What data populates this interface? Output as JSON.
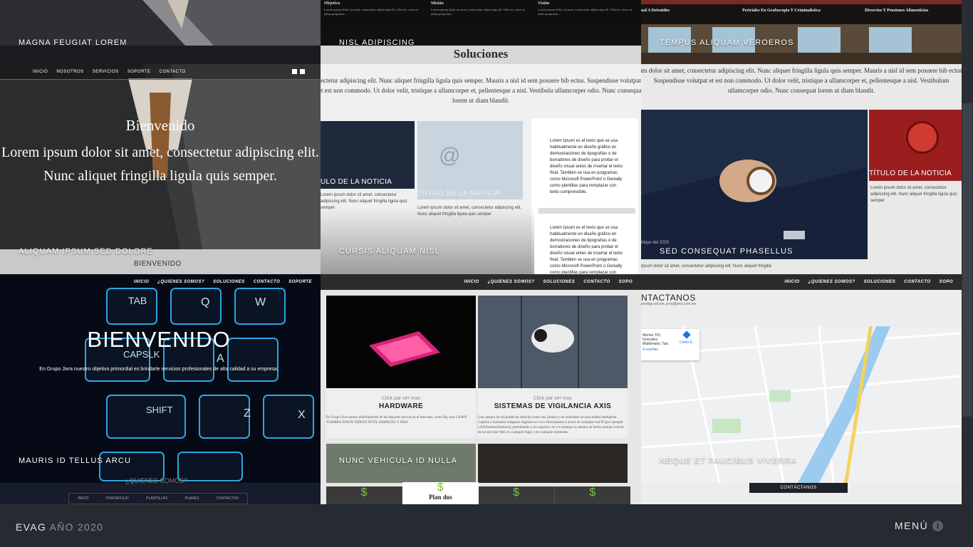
{
  "footer": {
    "brand": "EVAG",
    "year": "AÑO 2020",
    "menu_label": "MENÚ",
    "info_icon": "info-icon"
  },
  "tiles": {
    "t1": {
      "label": "MAGNA FEUGIAT LOREM"
    },
    "t2": {
      "label": "NISL ADIPISCING",
      "heading": "Soluciones",
      "subheading": "BIENVENIDO",
      "columns": [
        "Objetivo",
        "Misión",
        "Visión"
      ],
      "col_text": "Lorem ipsum dolor sit amet, consectetur adipiscing elit. Ultrices, vitae eu nibus proprietor..."
    },
    "t3": {
      "label": "TEMPUS ALIQUAM VEROEROS",
      "top_items": [
        "nal A Detenidos",
        "Periciales En Grafoscopia Y Criminalística",
        "Divorcios Y Pensiones Alimenticias"
      ]
    },
    "t4": {
      "label": "ALIQUAM IPSUM SED DOLORE",
      "nav": [
        "INICIO",
        "NOSOTROS",
        "SERVICIOS",
        "SOPORTE",
        "CONTACTO"
      ],
      "hero_title": "Bienvenido",
      "hero_text": "Lorem ipsum dolor sit amet, consectetur adipiscing elit. Nunc aliquet fringilla ligula quis semper.",
      "bottom": "BIENVENIDO"
    },
    "t5": {
      "label": "CURSIS ALIQUAM NISL",
      "intro": "ectetur adipiscing elit. Nunc aliquet fringilla ligula quis semper. Mauris a nisl id sem posuere bib ectus. Suspendisse volutpat et est non commodo. Ut dolor velit, tristique a ullamcorper et, pellentesque a nisl. Vestibulu ullamcorper odio. Nunc consequat lorem ut diam blandit.",
      "card1_title": "ULO DE LA NOTICIA",
      "card2_title": "TÍTULO DE LA NOTICIA",
      "card_text": "Lorem ipsum dolor sit amet, consectetur adipiscing elit. Nunc aliquet fringilla ligula quis semper",
      "side_text": "Lorem Ipsum es el texto que se usa habitualmente en diseño gráfico en demostraciones de tipografías o de borradores de diseño para probar el diseño visual antes de insertar el texto final. También se usa en programas como Microsoft PowerPoint o Genially como plantillas para remplazar con texto comprensible."
    },
    "t6": {
      "label": "SED CONSEQUAT PHASELLUS",
      "intro": "um dolor sit amet, consectetur adipiscing elit. Nunc aliquet fringilla ligula quis semper. Mauris a nisl id sem posuere bib ectus. Suspendisse volutpat et est non commodo. Ut dolor velit, tristique a ullamcorper et, pellentesque a nisl. Vestibulum ullamcorper odio. Nunc consequat lorem ut diam blandit.",
      "card_title": "TÍTULO DE LA NOTICIA",
      "card_text": "Lorem ipsum dolor sit amet, consectetur adipiscing elit. Nunc aliquet fringilla ligula quis semper",
      "bottom_text": "ipsum dolor sit amet, consectetur adipiscing elit. Nunc aliquet fringilla",
      "date": "Mayo del 2020"
    },
    "t7": {
      "label": "MAURIS ID TELLUS ARCU",
      "nav": [
        "INICIO",
        "¿QUIENES SOMOS?",
        "SOLUCIONES",
        "CONTACTO",
        "SOPORTE"
      ],
      "hero_title": "BIENVENIDO",
      "hero_text": "En Grupo Jivra nuestro objetivo primordial es brindarle servicios profesionales de alta calidad a su empresa.",
      "section": "¿QUIENES SOMOS?",
      "subnav": [
        "INICIO",
        "PORTAFOLIO",
        "PLANTILLAS",
        "PLANES",
        "CONTACTOS"
      ]
    },
    "t8": {
      "label": "NUNC VEHICULA ID NULLA",
      "nav": [
        "INICIO",
        "¿QUIENES SOMOS?",
        "SOLUCIONES",
        "CONTACTO",
        "SOPO"
      ],
      "click_text": "Click par ver mas",
      "card1_title": "HARDWARE",
      "card2_title": "SISTEMAS DE VIGILANCIA AXIS",
      "card1_text": "En Grupo Jivra somos distribuidores de las mayores marcas en el mercado, como Hp, acer LANIX TOSHIBA EPSON XEROX INTEL SAMSUNG Y MAS",
      "card2_text": "Una cámara de red puede ser descrita como una cámara y un ordenador en una unidad inteligente. Captura y transmite imágenes digitales en vivo directamente a través de cualquier red IP (por ejemplo LAN/Intranet/Internet), permitiendo a los usuarios ver y/o manejar la cámara de forma remota a través de un servidor Web en cualquier lugar y en cualquier momento.",
      "plans": [
        "$",
        "$",
        "$",
        "$"
      ],
      "plan_featured": "Plan dos"
    },
    "t9": {
      "label": "NEQUE ET FAUCIBUS VIVERRA",
      "nav": [
        "INICIO",
        "¿QUIENES SOMOS?",
        "SOLUCIONES",
        "CONTACTO",
        "SOPO"
      ],
      "heading": "NTACTANOS",
      "email": "prodigy.net.mx, jivra@jivra.com.mx",
      "map_card": "Merino 701, Gonzalez Maldonado, Tab.",
      "map_reviews": "9 reseñas",
      "map_link": "Cómo ll...",
      "button": "CONTÁCTANOS"
    }
  }
}
